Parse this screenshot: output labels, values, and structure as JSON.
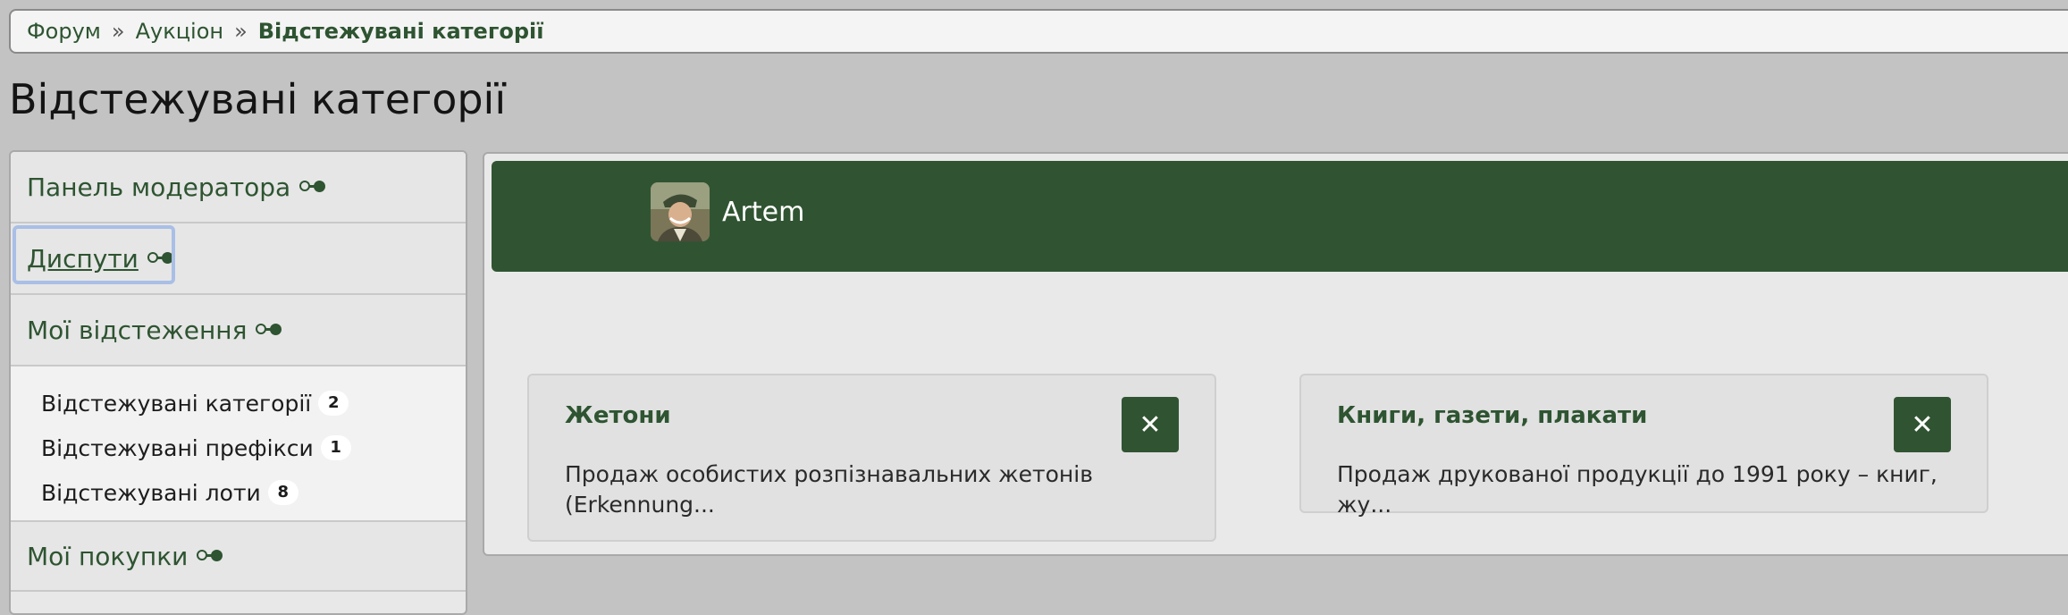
{
  "breadcrumb": {
    "items": [
      "Форум",
      "Аукціон",
      "Відстежувані категорії"
    ],
    "separator": "»"
  },
  "page": {
    "title": "Відстежувані категорії"
  },
  "sidebar": {
    "blocks": [
      {
        "label": "Панель модератора"
      },
      {
        "label": "Диспути"
      },
      {
        "label": "Мої відстеження"
      }
    ],
    "sub_items": [
      {
        "label": "Відстежувані категорії",
        "count": "2"
      },
      {
        "label": "Відстежувані префікси",
        "count": "1"
      },
      {
        "label": "Відстежувані лоти",
        "count": "8"
      }
    ],
    "purchases": {
      "label": "Мої покупки"
    }
  },
  "user": {
    "name": "Artem",
    "avatar_icon": "user-avatar-photo"
  },
  "categories": [
    {
      "title": "Жетони",
      "description": "Продаж особистих розпізнавальних жетонів (Erkennung...",
      "remove_icon": "close-icon"
    },
    {
      "title": "Книги, газети, плакати",
      "description": "Продаж друкованої продукції до 1991 року – книг, жу...",
      "remove_icon": "close-icon"
    }
  ],
  "colors": {
    "accent": "#305432",
    "link": "#2e5431",
    "background": "#c3c3c3",
    "focus_outline": "#a9bfe6"
  }
}
